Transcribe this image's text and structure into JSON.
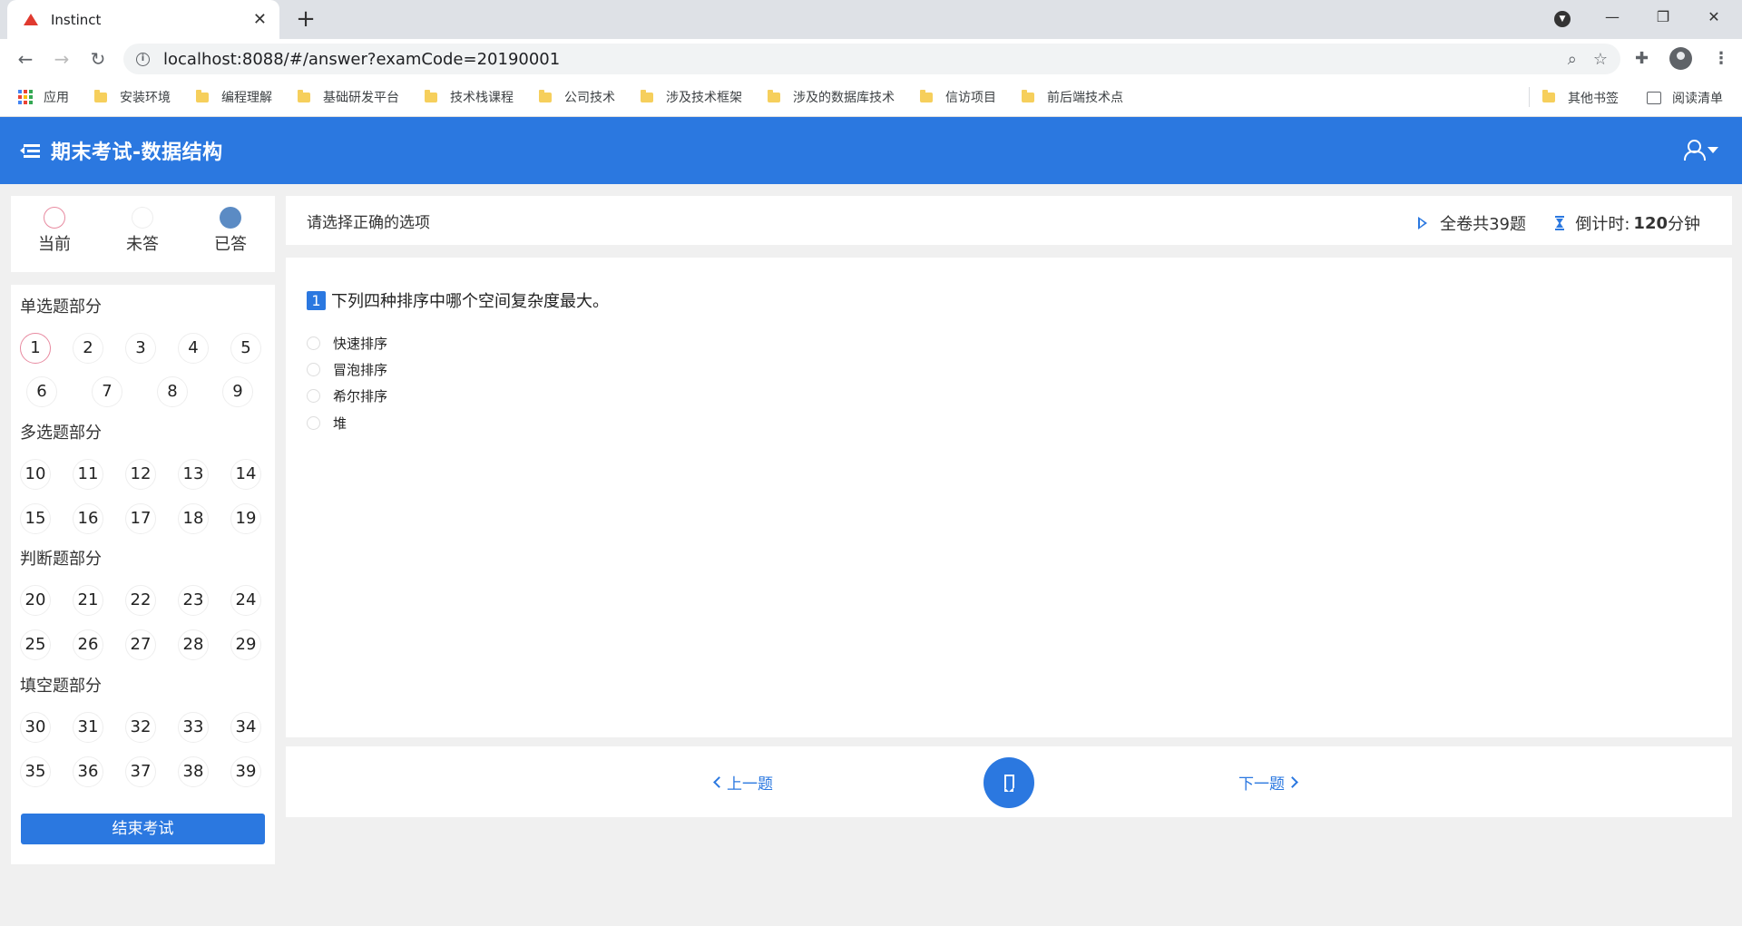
{
  "browser": {
    "tab_title": "Instinct",
    "url": "localhost:8088/#/answer?examCode=20190001",
    "bookmarks": [
      {
        "label": "应用"
      },
      {
        "label": "安装环境"
      },
      {
        "label": "编程理解"
      },
      {
        "label": "基础研发平台"
      },
      {
        "label": "技术栈课程"
      },
      {
        "label": "公司技术"
      },
      {
        "label": "涉及技术框架"
      },
      {
        "label": "涉及的数据库技术"
      },
      {
        "label": "信访项目"
      },
      {
        "label": "前后端技术点"
      }
    ],
    "other_bookmarks": "其他书签",
    "reading_list": "阅读清单"
  },
  "header": {
    "title": "期末考试-数据结构"
  },
  "legend": {
    "current": "当前",
    "unanswered": "未答",
    "answered": "已答"
  },
  "sections": [
    {
      "title": "单选题部分",
      "numbers": [
        "1",
        "2",
        "3",
        "4",
        "5",
        "6",
        "7",
        "8",
        "9"
      ]
    },
    {
      "title": "多选题部分",
      "numbers": [
        "10",
        "11",
        "12",
        "13",
        "14",
        "15",
        "16",
        "17",
        "18",
        "19"
      ]
    },
    {
      "title": "判断题部分",
      "numbers": [
        "20",
        "21",
        "22",
        "23",
        "24",
        "25",
        "26",
        "27",
        "28",
        "29"
      ]
    },
    {
      "title": "填空题部分",
      "numbers": [
        "30",
        "31",
        "32",
        "33",
        "34",
        "35",
        "36",
        "37",
        "38",
        "39"
      ]
    }
  ],
  "current_question": "1",
  "end_button": "结束考试",
  "info": {
    "instruction": "请选择正确的选项",
    "total": "全卷共39题",
    "countdown_label": "倒计时:",
    "countdown_value": "120",
    "countdown_unit": "分钟"
  },
  "question": {
    "number": "1",
    "text": "下列四种排序中哪个空间复杂度最大。",
    "options": [
      "快速排序",
      "冒泡排序",
      "希尔排序",
      "堆"
    ]
  },
  "nav": {
    "prev": "上一题",
    "next": "下一题"
  },
  "colors": {
    "primary": "#2b78e0",
    "current_ring": "#e88aa0",
    "answered_dot": "#5b8bc4"
  }
}
